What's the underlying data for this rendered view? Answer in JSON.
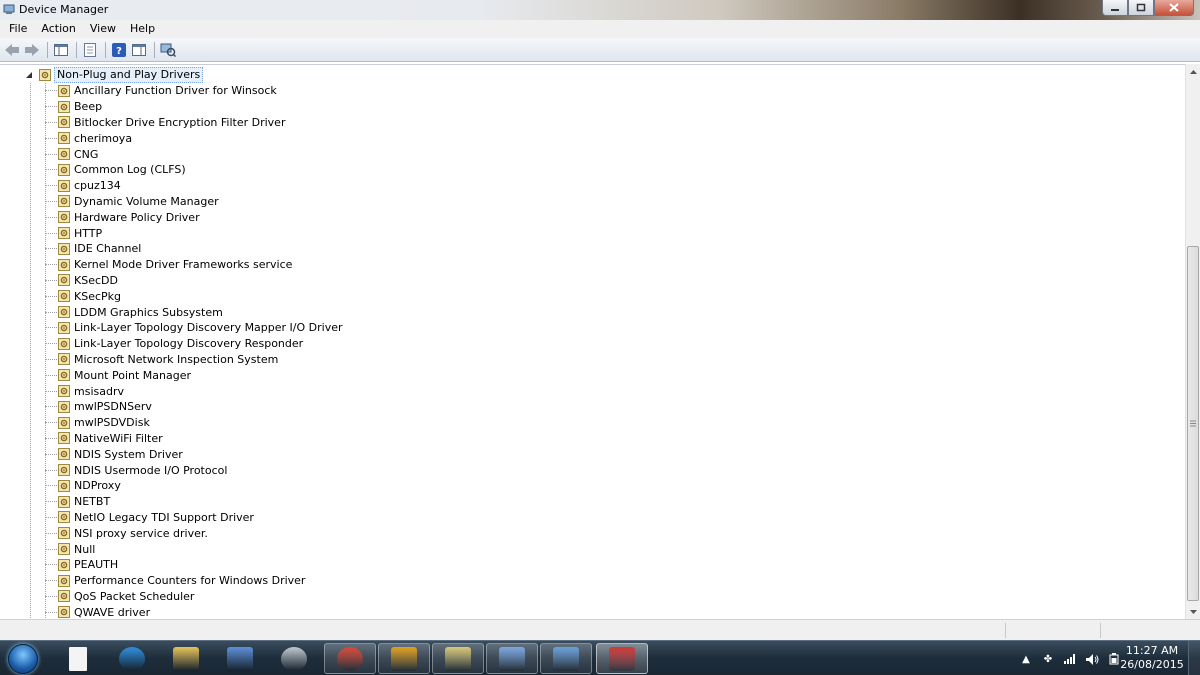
{
  "window": {
    "title": "Device Manager",
    "controls": [
      "minimize-icon",
      "maximize-icon",
      "close-icon"
    ]
  },
  "menu": [
    "File",
    "Action",
    "View",
    "Help"
  ],
  "toolbar": {
    "buttons": [
      "back-arrow-icon",
      "forward-arrow-icon",
      "show-hide-console-tree-icon",
      "properties-icon",
      "help-icon",
      "show-action-pane-icon",
      "scan-hardware-changes-icon"
    ]
  },
  "tree": {
    "root_label": "Non-Plug and Play Drivers",
    "items": [
      "Ancillary Function Driver for Winsock",
      "Beep",
      "Bitlocker Drive Encryption Filter Driver",
      "cherimoya",
      "CNG",
      "Common Log (CLFS)",
      "cpuz134",
      "Dynamic Volume Manager",
      "Hardware Policy Driver",
      "HTTP",
      "IDE Channel",
      "Kernel Mode Driver Frameworks service",
      "KSecDD",
      "KSecPkg",
      "LDDM Graphics Subsystem",
      "Link-Layer Topology Discovery Mapper I/O Driver",
      "Link-Layer Topology Discovery Responder",
      "Microsoft Network Inspection System",
      "Mount Point Manager",
      "msisadrv",
      "mwlPSDNServ",
      "mwlPSDVDisk",
      "NativeWiFi Filter",
      "NDIS System Driver",
      "NDIS Usermode I/O Protocol",
      "NDProxy",
      "NETBT",
      "NetIO Legacy TDI Support Driver",
      "NSI proxy service driver.",
      "Null",
      "PEAUTH",
      "Performance Counters for Windows Driver",
      "QoS Packet Scheduler",
      "QWAVE driver"
    ]
  },
  "taskbar": {
    "items": [
      {
        "name": "blank-document-icon",
        "color": "#f4f4f4"
      },
      {
        "name": "internet-explorer-icon",
        "color": "#2e8fe0"
      },
      {
        "name": "file-explorer-icon",
        "color": "#e8c25a"
      },
      {
        "name": "paint-tools-icon",
        "color": "#5a8fd8"
      },
      {
        "name": "media-player-icon",
        "color": "#c0c8d0"
      },
      {
        "name": "chrome-icon",
        "color": "#d94a38"
      },
      {
        "name": "media-app-icon",
        "color": "#e0a020"
      },
      {
        "name": "explorer-window-icon",
        "color": "#d8c878"
      },
      {
        "name": "paint-icon",
        "color": "#7aa8e0"
      },
      {
        "name": "control-panel-icon",
        "color": "#6aa0d8"
      },
      {
        "name": "toolbox-icon",
        "color": "#d03a3a"
      }
    ],
    "clock_time": "11:27 AM",
    "clock_date": "26/08/2015"
  },
  "colors": {
    "selection": "#e6f0fb",
    "taskbar": "#1e2d3b"
  }
}
